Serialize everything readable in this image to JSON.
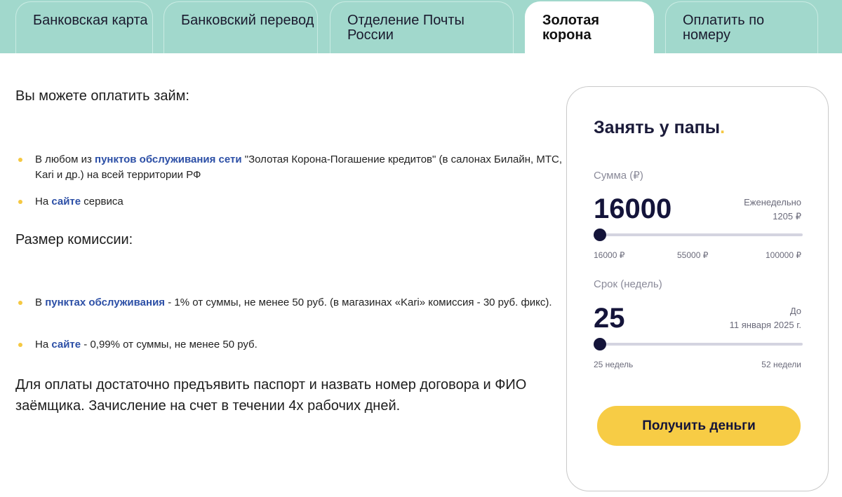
{
  "tabs": [
    {
      "label": "Банковская карта",
      "active": false
    },
    {
      "label": "Банковский перевод",
      "active": false
    },
    {
      "label": "Отделение Почты России",
      "active": false
    },
    {
      "label": "Золотая корона",
      "active": true
    },
    {
      "label": "Оплатить по номеру",
      "active": false
    }
  ],
  "content": {
    "pay_heading": "Вы можете оплатить займ:",
    "pay_items": [
      {
        "pre": "В любом из ",
        "link": "пунктов обслуживания сети",
        "post": " \"Золотая Корона-Погашение кредитов\" (в салонах Билайн, МТС, Kari и др.) на всей территории РФ"
      },
      {
        "pre": "На ",
        "link": "сайте",
        "post": " сервиса"
      }
    ],
    "commission_heading": "Размер комиссии:",
    "commission_items": [
      {
        "pre": "В ",
        "link": "пунктах обслуживания",
        "post": " - 1% от суммы, не менее 50 руб. (в магазинах «Kari» комиссия - 30 руб. фикс)."
      },
      {
        "pre": "На ",
        "link": "сайте",
        "post": " - 0,99% от суммы, не менее 50 руб."
      }
    ],
    "footer_text": "Для оплаты достаточно предъявить паспорт и назвать номер договора и ФИО заёмщика. Зачисление на счет в течении 4х рабочих дней."
  },
  "calculator": {
    "title": "Занять у папы",
    "title_dot": ".",
    "sum_label": "Сумма (₽)",
    "sum_value": "16000",
    "weekly_label": "Еженедельно",
    "weekly_value": "1205 ₽",
    "sum_scale": [
      "16000 ₽",
      "55000 ₽",
      "100000 ₽"
    ],
    "sum_position": 0,
    "term_label": "Срок (недель)",
    "term_value": "25",
    "until_label": "До",
    "until_date": "11 января 2025 г.",
    "term_scale": [
      "25 недель",
      "52 недели"
    ],
    "term_position": 0,
    "cta_label": "Получить деньги"
  },
  "colors": {
    "tab_bar": "#a1d8cc",
    "link": "#2c4fa6",
    "bullet": "#f5c842",
    "cta": "#f7cc45",
    "dark": "#14143a"
  }
}
